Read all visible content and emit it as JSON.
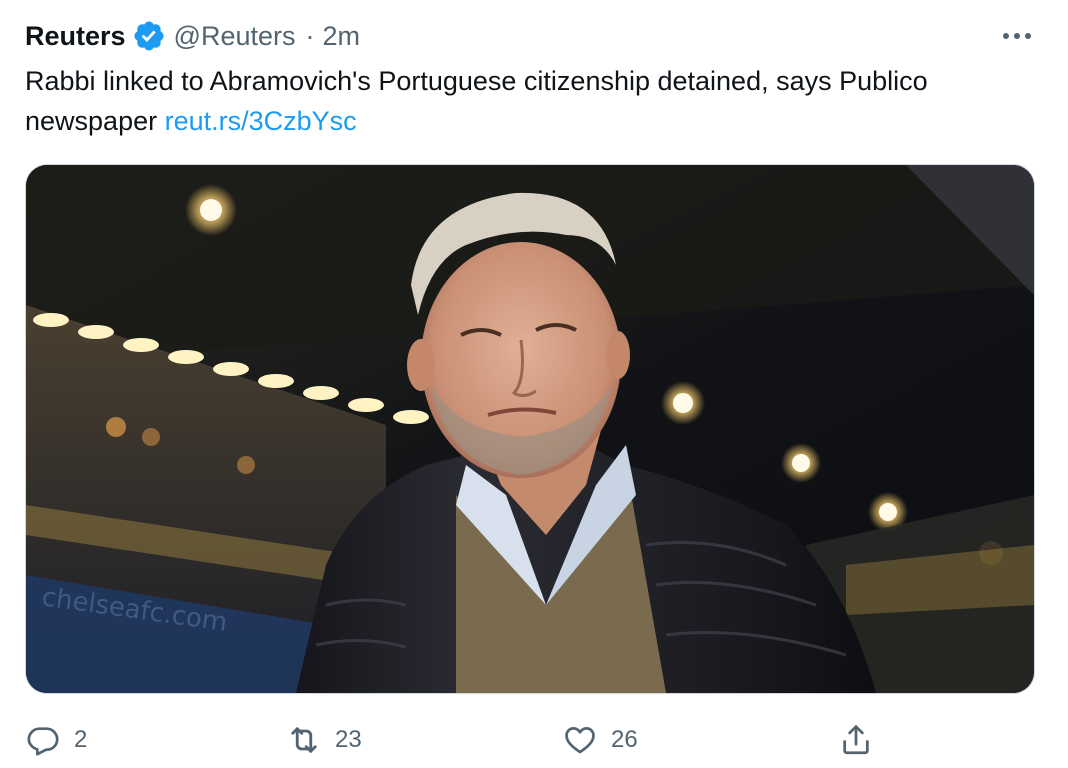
{
  "tweet": {
    "author_name": "Reuters",
    "verified_icon": "verified-badge-icon",
    "handle": "@Reuters",
    "separator": "·",
    "time": "2m",
    "more_icon": "more-horizontal-icon",
    "text_before_link": "Rabbi linked to Abramovich's Portuguese citizenship detained, says Publico newspaper ",
    "link_text": "reut.rs/3CzbYsc",
    "media_description": "photo-man-in-puffer-jacket-in-stadium"
  },
  "actions": {
    "reply": {
      "icon": "reply-icon",
      "count": "2"
    },
    "retweet": {
      "icon": "retweet-icon",
      "count": "23"
    },
    "like": {
      "icon": "heart-icon",
      "count": "26"
    },
    "share": {
      "icon": "share-icon"
    }
  },
  "colors": {
    "text": "#0f1419",
    "muted": "#536471",
    "link": "#1d9bf0",
    "verified": "#1d9bf0",
    "border": "#cfd9de"
  }
}
